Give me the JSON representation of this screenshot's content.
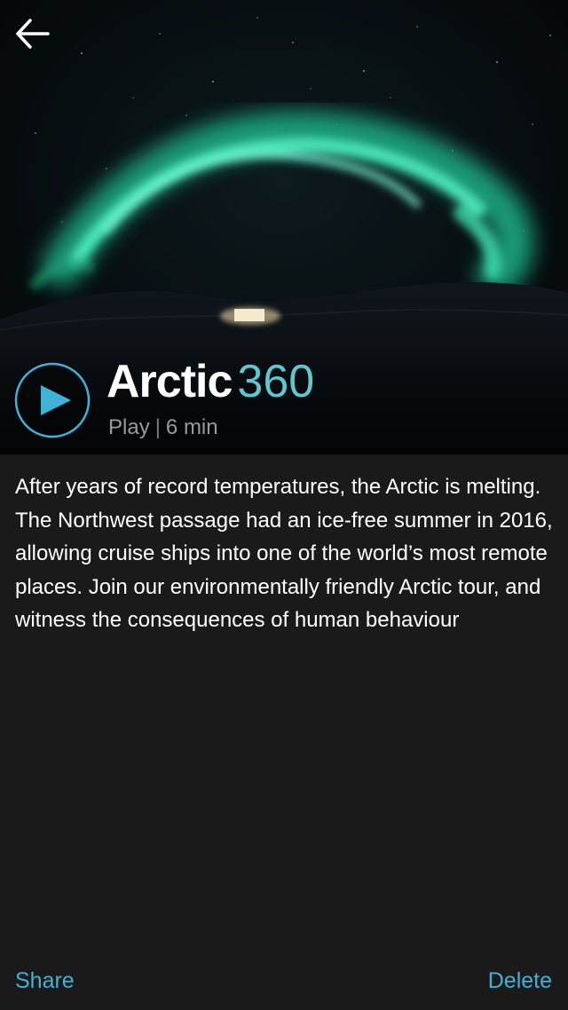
{
  "header": {
    "back_icon": "arrow-left-icon"
  },
  "media": {
    "title": "Arctic",
    "title_suffix": "360",
    "play_label": "Play",
    "separator": "|",
    "duration": "6 min",
    "play_icon": "play-icon",
    "accent_color": "#5ec7cf"
  },
  "description": "After years of record temperatures, the Arctic is melting. The Northwest passage had an ice-free summer in 2016, allowing cruise ships into one of the world’s most remote places. Join our environmentally friendly Arctic tour, and witness the consequences of human behaviour",
  "footer": {
    "share_label": "Share",
    "delete_label": "Delete",
    "link_color": "#3fb2d8"
  }
}
